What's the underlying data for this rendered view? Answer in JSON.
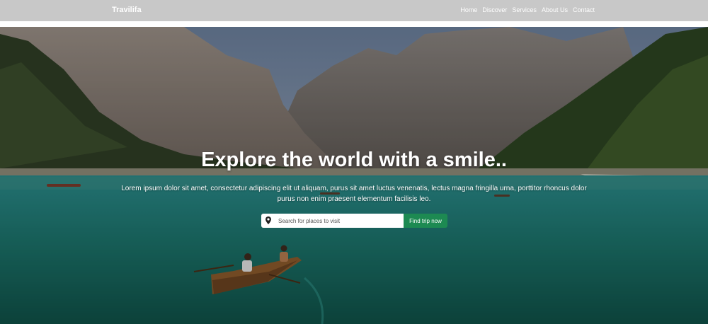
{
  "brand": {
    "name": "Travilifa"
  },
  "nav": {
    "items": [
      "Home",
      "Discover",
      "Services",
      "About Us",
      "Contact"
    ]
  },
  "hero": {
    "title": "Explore the world with a smile..",
    "description": "Lorem ipsum dolor sit amet, consectetur adipiscing elit ut aliquam, purus sit amet luctus venenatis, lectus magna fringilla urna, porttitor rhoncus dolor purus non enim praesent elementum facilisis leo."
  },
  "search": {
    "placeholder": "Search for places to visit",
    "button_label": "Find trip now",
    "icon": "map-pin-icon"
  },
  "colors": {
    "navbar_bg": "#c8c8c8",
    "button_bg": "#1d8a52",
    "lake": "#1f7c72"
  }
}
